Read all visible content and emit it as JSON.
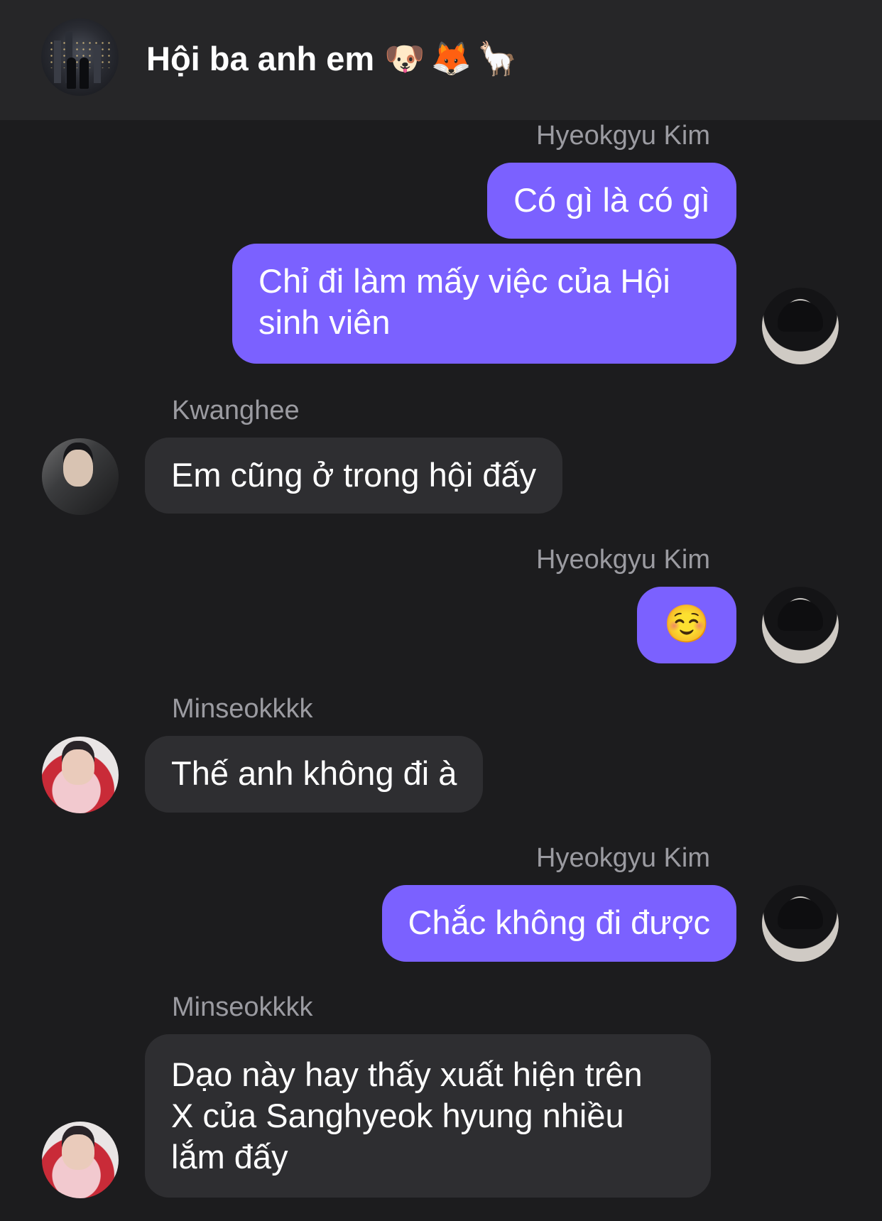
{
  "header": {
    "title": "Hội ba anh em",
    "emojis": [
      "🐶",
      "🦊",
      "🦙"
    ]
  },
  "messages": [
    {
      "sender": "Hyeokgyu Kim",
      "lines": [
        "Có gì là có gì"
      ]
    },
    {
      "lines": [
        "Chỉ đi làm mấy việc của Hội",
        "sinh viên"
      ]
    },
    {
      "sender": "Kwanghee",
      "lines": [
        "Em cũng ở trong hội đấy"
      ]
    },
    {
      "sender": "Hyeokgyu Kim",
      "lines": [
        "☺️"
      ]
    },
    {
      "sender": "Minseokkkk",
      "lines": [
        "Thế anh không đi à"
      ]
    },
    {
      "sender": "Hyeokgyu Kim",
      "lines": [
        "Chắc không đi được"
      ]
    },
    {
      "sender": "Minseokkkk",
      "lines": [
        "Dạo này hay thấy xuất hiện trên",
        "X của Sanghyeok hyung nhiều",
        "lắm đấy"
      ]
    }
  ],
  "colors": {
    "background": "#1c1c1e",
    "header": "#262628",
    "outgoing_bubble": "#7b61ff",
    "incoming_bubble": "#2e2e31",
    "sender_name": "#9b9ba1"
  }
}
